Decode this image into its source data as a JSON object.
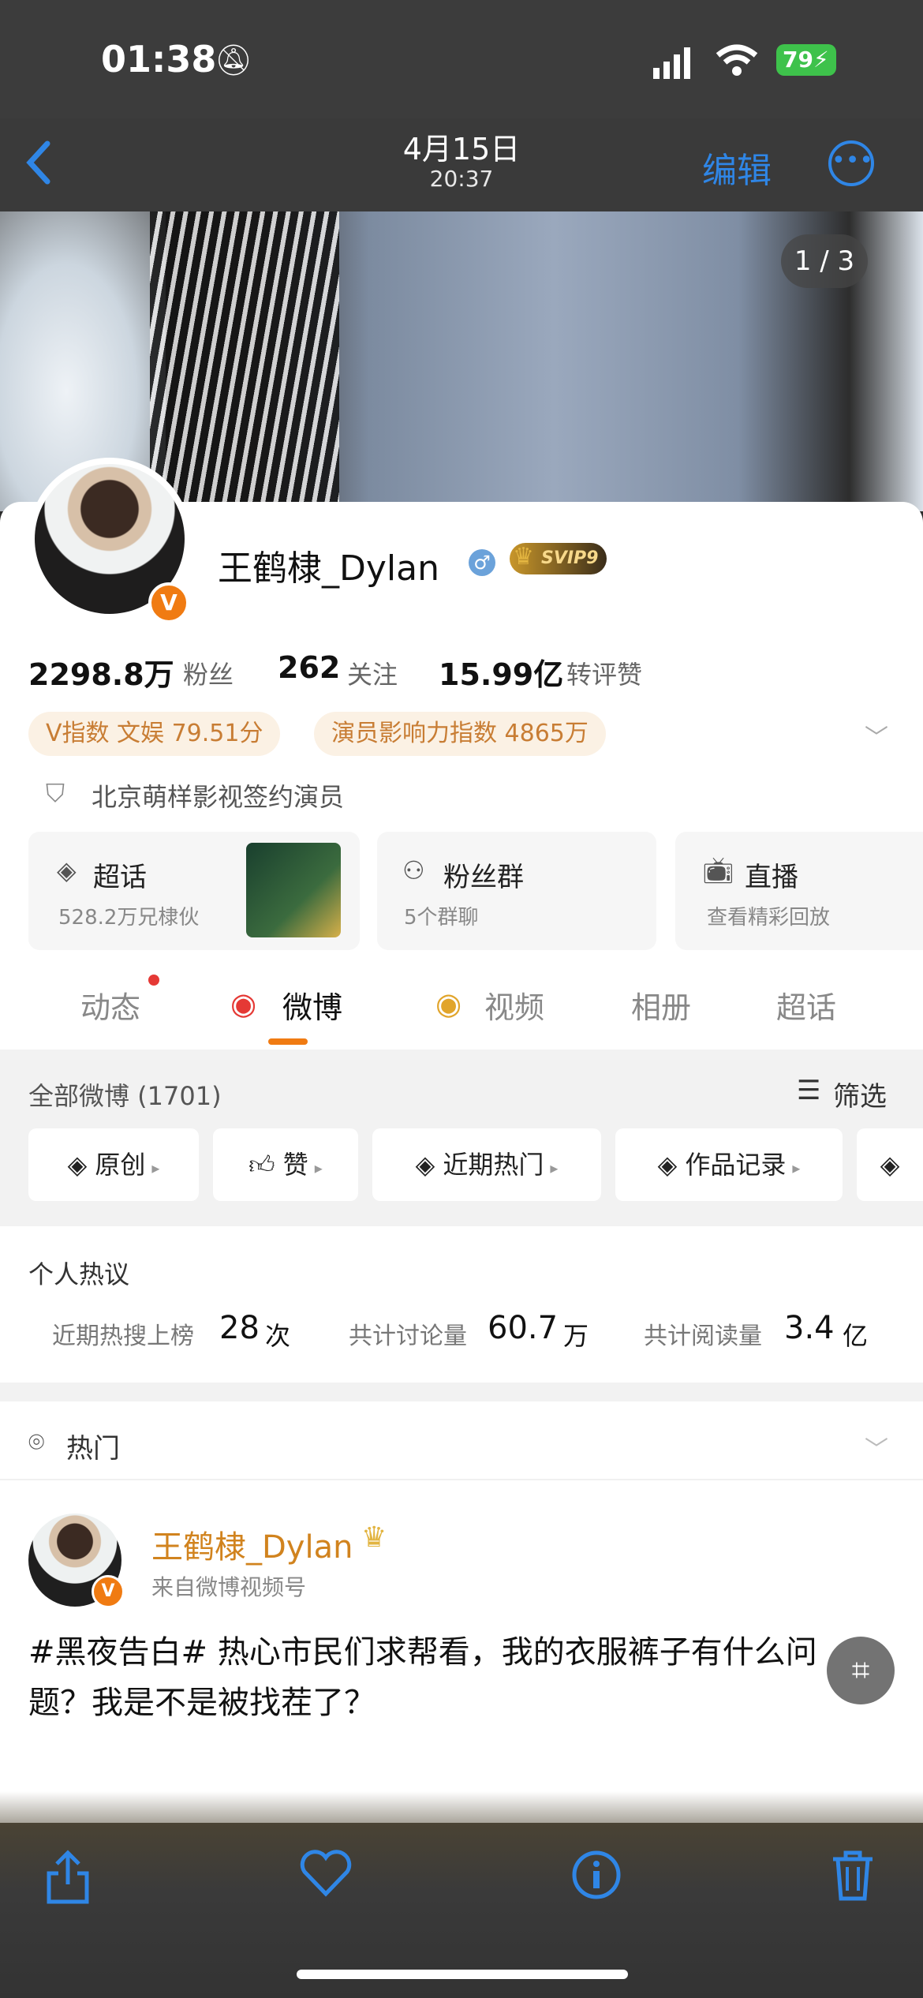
{
  "status_bar": {
    "time": "01:38",
    "battery": "79"
  },
  "nav": {
    "date": "4月15日",
    "time": "20:37",
    "edit_label": "编辑"
  },
  "cover": {
    "counter": "1 / 3"
  },
  "profile": {
    "username": "王鹤棣_Dylan",
    "gender_symbol": "♂",
    "svip_label": "SVIP9",
    "verified_mark": "V",
    "stats": [
      {
        "value": "2298.8万",
        "label": "粉丝"
      },
      {
        "value": "262",
        "label": "关注"
      },
      {
        "value": "15.99亿",
        "label": "转评赞"
      }
    ],
    "tags": [
      "V指数 文娱 79.51分",
      "演员影响力指数 4865万"
    ],
    "company": "北京萌样影视签约演员"
  },
  "features": [
    {
      "title": "超话",
      "sub": "528.2万兄棣伙"
    },
    {
      "title": "粉丝群",
      "sub": "5个群聊"
    },
    {
      "title": "直播",
      "sub": "查看精彩回放"
    }
  ],
  "tabs": [
    "动态",
    "微博",
    "视频",
    "相册",
    "超话"
  ],
  "posts_filter": {
    "all_label": "全部微博 (1701)",
    "filter_label": "筛选",
    "chips": [
      "原创",
      "赞",
      "近期热门",
      "作品记录"
    ]
  },
  "trending": {
    "title": "个人热议",
    "items": [
      {
        "label": "近期热搜上榜",
        "value": "28",
        "unit": "次"
      },
      {
        "label": "共计讨论量",
        "value": "60.7",
        "unit": "万"
      },
      {
        "label": "共计阅读量",
        "value": "3.4",
        "unit": "亿"
      }
    ]
  },
  "hot_section": {
    "title": "热门"
  },
  "post": {
    "author": "王鹤棣_Dylan",
    "source": "来自微博视频号",
    "text": "#黑夜告白# 热心市民们求帮看，我的衣服裤子有什么问题？我是不是被找茬了？"
  },
  "colors": {
    "accent": "#f07b12",
    "link_blue": "#2f86e6",
    "username_gold": "#d1831e"
  }
}
